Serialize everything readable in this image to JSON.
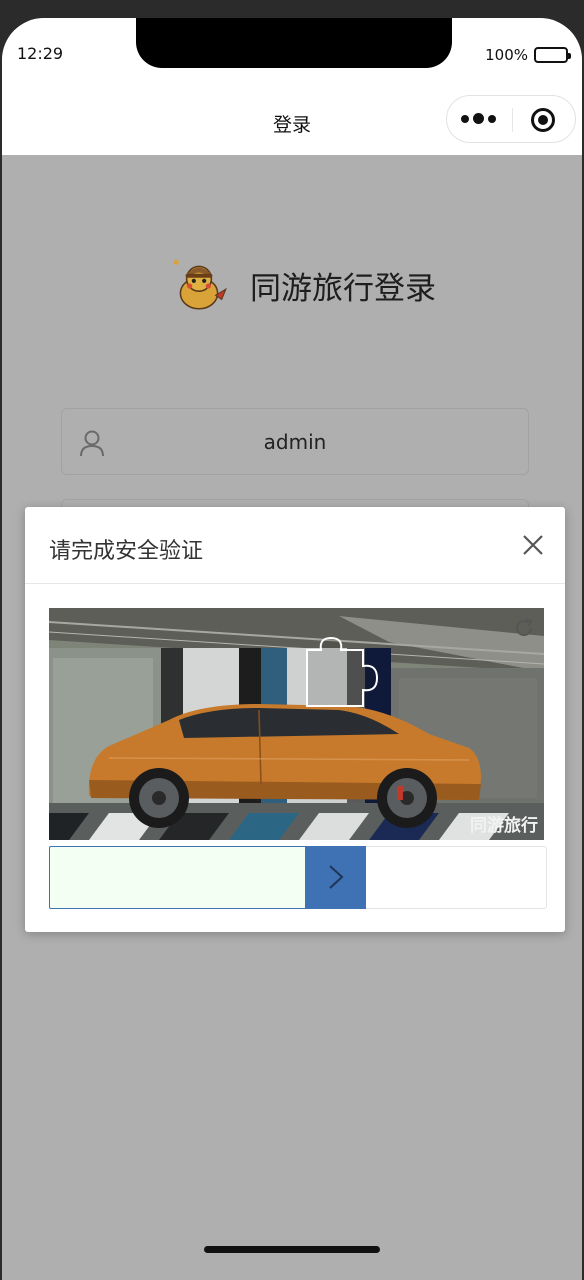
{
  "status": {
    "time": "12:29",
    "battery": "100%"
  },
  "nav": {
    "title": "登录"
  },
  "brand": {
    "title": "同游旅行登录"
  },
  "login": {
    "username_value": "admin"
  },
  "captcha": {
    "title": "请完成安全验证",
    "watermark": "同游旅行",
    "slider_progress": 0.52
  },
  "colors": {
    "overlay": "#afafaf",
    "slider_handle": "#3e72b4",
    "slider_fill": "#f3fff3",
    "car": "#c77a2b"
  },
  "icons": {
    "more": "more-dots-icon",
    "close_capsule": "target-icon",
    "user": "user-icon",
    "close": "close-icon",
    "refresh": "refresh-icon",
    "arrow": "chevron-right-icon"
  }
}
